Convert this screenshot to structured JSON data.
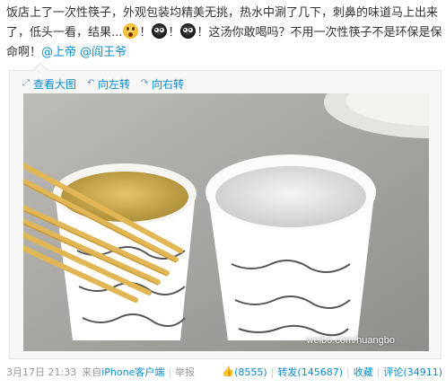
{
  "post": {
    "text_part1": "饭店上了一次性筷子，外观包装均精美无挑，热水中涮了几下，刺鼻的味道马上出来了，低头一看，结果...",
    "excl1": "！",
    "excl2": "！",
    "text_part2": "！这汤你敢喝吗？不用一次性筷子不是环保是保命啊！",
    "mention1": "@上帝",
    "mention2": "@阎王爷",
    "emojis": [
      "surprised-emoji",
      "dark-eyes-emoji",
      "dark-eyes-emoji"
    ]
  },
  "media": {
    "tools": [
      {
        "icon": "magnify-icon",
        "label": "查看大图"
      },
      {
        "icon": "rotate-left-icon",
        "label": "向左转"
      },
      {
        "icon": "rotate-right-icon",
        "label": "向右转"
      }
    ],
    "watermark": "weibo.com/huangbo"
  },
  "footer": {
    "time": "3月17日 21:33",
    "from_prefix": "来自",
    "source": "iPhone客户端",
    "report": "举报",
    "like_count": "(8555)",
    "repost_label": "转发",
    "repost_count": "(145687)",
    "fav_label": "收藏",
    "comment_label": "评论",
    "comment_count": "(34911)",
    "separator": "|"
  },
  "colors": {
    "link": "#0a8cd2",
    "muted": "#999999",
    "soup": "#c9a64a",
    "chopsticks": "#e2b655"
  }
}
